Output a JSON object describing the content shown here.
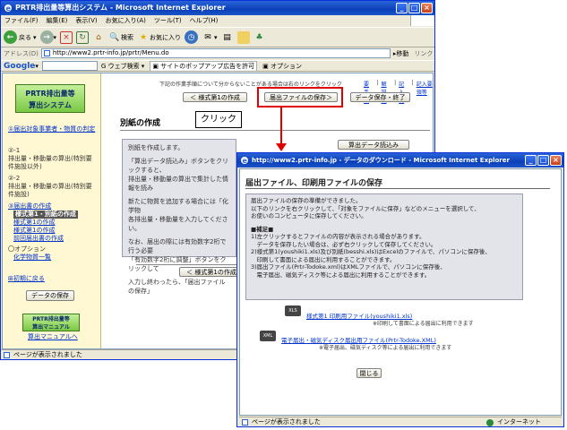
{
  "main_window": {
    "title": "PRTR排出量等算出システム - Microsoft Internet Explorer",
    "menu": [
      "ファイル(F)",
      "編集(E)",
      "表示(V)",
      "お気に入り(A)",
      "ツール(T)",
      "ヘルプ(H)"
    ],
    "toolbar": {
      "back": "戻る",
      "search": "検索",
      "favorites": "お気に入り"
    },
    "address_label": "アドレス(D)",
    "address_value": "http://www2.prtr-info.jp/prtr/Menu.do",
    "go_label": "移動",
    "links_label": "リンク",
    "google": {
      "logo": "Google",
      "search": "ウェブ検索",
      "popup_block": "サイトのポップアップ広告を許可",
      "options": "オプション"
    },
    "status": "ページが表示されました"
  },
  "sidebar": {
    "logo": {
      "line1": "PRTR排出量等",
      "line2": "算出システム"
    },
    "item1": "①届出対象事業者・物質の判定",
    "item2_title": "②-1",
    "item2_text": "排出量・移動量の算出(特別要件施設以外)",
    "item3_title": "②-2",
    "item3_text": "排出量・移動量の算出(特別要件施設)",
    "item4_title": "③届出書の作成",
    "item4_sub": [
      "様式第1・別紙の作成",
      "様式第1の作成",
      "様式第1の作成",
      "前回届出書の作成"
    ],
    "item5_title": "〇オプション",
    "item5_sub": "化学物質一覧",
    "item6": "⊞初期に戻る",
    "save_button": "データの保存",
    "logo_small": {
      "line1": "PRTR排出量等",
      "line2": "算出マニュアル"
    },
    "manual_link": "算出マニュアルへ"
  },
  "content": {
    "note": "下記の作業手順について分からないことがある場合は右のリンクをクリック",
    "links": [
      "要手順",
      "解説編",
      "記入例",
      "記入要領等"
    ],
    "nav_prev": "＜ 様式第1の作成",
    "nav_save": "届出ファイルの保存＞",
    "nav_end": "データ保存・終了",
    "section_title": "別紙の作成",
    "calc_button": "算出データ読込み",
    "para1": "別紙を作成します。",
    "para2": "「算出データ読込み」ボタンをクリックすると、",
    "para2b": "排出量・移動量の算出で集計した情報を読み",
    "para3": "新たに物質を追加する場合には「化学物",
    "para3b": "各排出量・移動量を入力してください。",
    "para4": "なお、届出の際には有効数字2桁で行う必要",
    "para4b": "「有効数字2桁に調整」ボタンをクリックして",
    "para5": "入力し終わったら、「届出ファイルの保存」",
    "bottom_prev": "＜ 様式第1の作成"
  },
  "callout": {
    "label": "クリック"
  },
  "popup": {
    "title": "http://www2.prtr-info.jp - データのダウンロード - Microsoft Internet Explorer",
    "heading": "届出ファイル、印刷用ファイルの保存",
    "box_lines": [
      "届出ファイルの保存の準備ができました。",
      "以下のリンクを右クリックして、「対象をファイルに保存」などのメニューを選択して、",
      "お使いのコンピュータに保存してください。",
      "",
      "■補足■",
      "1)左クリックするとファイルの内容が表示される場合があります。",
      "　データを保存したい場合は、必ず右クリックして保存してください。",
      "2)様式第1(youshiki1.xls)及び別紙(besshi.xls)はExcelのファイルで、パソコンに保存後、",
      "　印刷して書面による届出に利用することができます。",
      "3)届出ファイル(Prtr-Todoke.xml)はXMLファイルで、パソコンに保存後、",
      "　電子届出、磁気ディスク等による届出に利用することができます。"
    ],
    "file1_link": "様式第1 印刷用ファイル(youshiki1.xls)",
    "file1_note": "※印刷して書面による届出に利用できます",
    "file2_link": "電子届出・磁気ディスク届出用ファイル(Prtr-Todoke.XML)",
    "file2_note": "※電子届出、磁気ディスク等による届出に利用できます",
    "close_button": "閉じる",
    "status": "ページが表示されました",
    "zone": "インターネット"
  }
}
